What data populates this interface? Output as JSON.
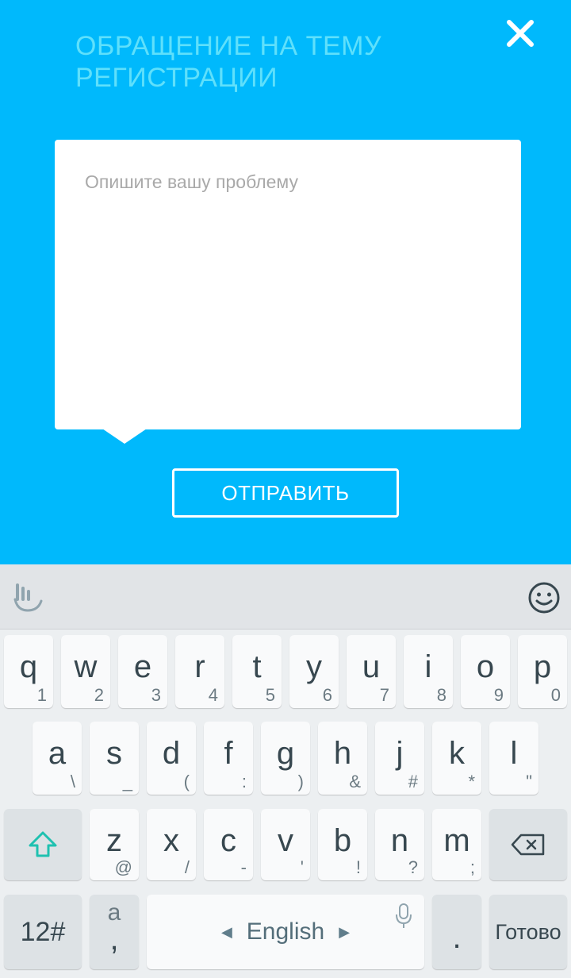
{
  "header": {
    "title": "ОБРАЩЕНИЕ НА ТЕМУ РЕГИСТРАЦИИ",
    "close_icon": "close-icon"
  },
  "form": {
    "problem_placeholder": "Опишите вашу проблему",
    "problem_value": "",
    "submit_label": "ОТПРАВИТЬ"
  },
  "colors": {
    "background": "#00b9fc",
    "title": "#5fe0fb",
    "keyboard_bg": "#eceff1",
    "shift_accent": "#1fc1b0"
  },
  "keyboard": {
    "toolbar": {
      "logo_icon": "touchpal-logo-icon",
      "emoji_icon": "smiley-icon"
    },
    "row1": [
      {
        "main": "q",
        "sub": "1"
      },
      {
        "main": "w",
        "sub": "2"
      },
      {
        "main": "e",
        "sub": "3"
      },
      {
        "main": "r",
        "sub": "4"
      },
      {
        "main": "t",
        "sub": "5"
      },
      {
        "main": "y",
        "sub": "6"
      },
      {
        "main": "u",
        "sub": "7"
      },
      {
        "main": "i",
        "sub": "8"
      },
      {
        "main": "o",
        "sub": "9"
      },
      {
        "main": "p",
        "sub": "0"
      }
    ],
    "row2": [
      {
        "main": "a",
        "sub": "\\"
      },
      {
        "main": "s",
        "sub": "_"
      },
      {
        "main": "d",
        "sub": "("
      },
      {
        "main": "f",
        "sub": ":"
      },
      {
        "main": "g",
        "sub": ")"
      },
      {
        "main": "h",
        "sub": "&"
      },
      {
        "main": "j",
        "sub": "#"
      },
      {
        "main": "k",
        "sub": "*"
      },
      {
        "main": "l",
        "sub": "\""
      }
    ],
    "row3": [
      {
        "main": "z",
        "sub": "@"
      },
      {
        "main": "x",
        "sub": "/"
      },
      {
        "main": "c",
        "sub": "-"
      },
      {
        "main": "v",
        "sub": "'"
      },
      {
        "main": "b",
        "sub": "!"
      },
      {
        "main": "n",
        "sub": "?"
      },
      {
        "main": "m",
        "sub": ";"
      }
    ],
    "shift_icon": "shift-arrow-icon",
    "backspace_icon": "backspace-icon",
    "numbers_label": "12#",
    "punct_top": "a",
    "punct_bottom": ",",
    "space_label": "English",
    "mic_icon": "microphone-icon",
    "period_label": ".",
    "done_label": "Готово"
  }
}
